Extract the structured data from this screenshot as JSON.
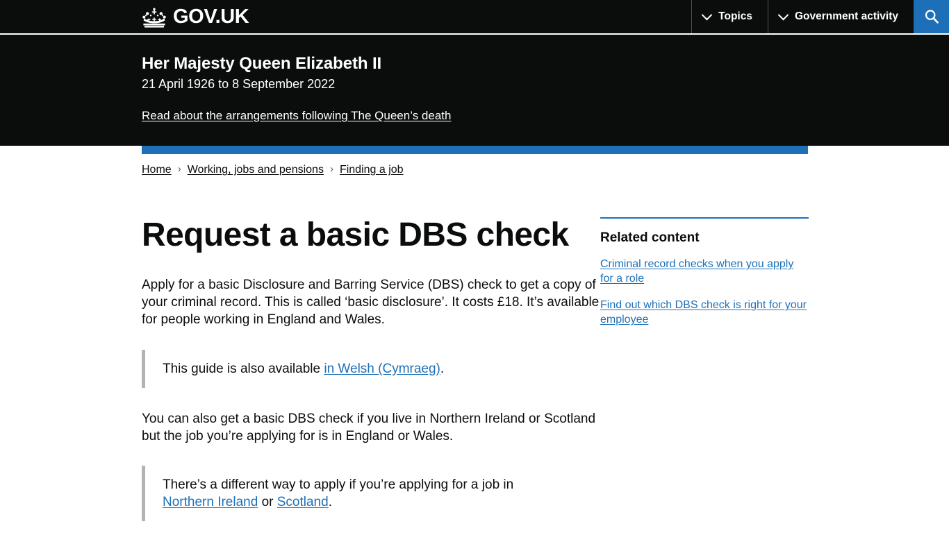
{
  "header": {
    "logo_text": "GOV.UK",
    "crown_icon": "crown-icon",
    "nav": [
      {
        "label": "Topics",
        "icon": "chevron-down-icon"
      },
      {
        "label": "Government activity",
        "icon": "chevron-down-icon"
      }
    ],
    "search_icon": "search-icon",
    "search_label": "Search"
  },
  "banner": {
    "title": "Her Majesty Queen Elizabeth II",
    "dates": "21 April 1926 to 8 September 2022",
    "link": "Read about the arrangements following The Queen’s death"
  },
  "breadcrumbs": [
    {
      "label": "Home"
    },
    {
      "label": "Working, jobs and pensions"
    },
    {
      "label": "Finding a job"
    }
  ],
  "breadcrumb_separator": "›",
  "main": {
    "title": "Request a basic DBS check",
    "paragraph_1": "Apply for a basic Disclosure and Barring Service (DBS) check to get a copy of your criminal record. This is called ‘basic disclosure’. It costs £18. It’s available for people working in England and Wales.",
    "inset_1": {
      "prefix": "This guide is also available ",
      "link": "in Welsh (Cymraeg)",
      "suffix": "."
    },
    "paragraph_2": "You can also get a basic DBS check if you live in Northern Ireland or Scotland but the job you’re applying for is in England or Wales.",
    "inset_2": {
      "prefix": "There’s a different way to apply if you’re applying for a job in ",
      "link_1": "Northern Ireland",
      "middle": " or ",
      "link_2": "Scotland",
      "suffix": "."
    }
  },
  "related": {
    "heading": "Related content",
    "links": [
      {
        "label": "Criminal record checks when you apply for a role"
      },
      {
        "label": "Find out which DBS check is right for your employee"
      }
    ]
  },
  "colors": {
    "brand_blue": "#1d70b8",
    "black": "#0b0c0c",
    "inset_border": "#b1b4b6",
    "breadcrumb_sep": "#505a5f"
  }
}
